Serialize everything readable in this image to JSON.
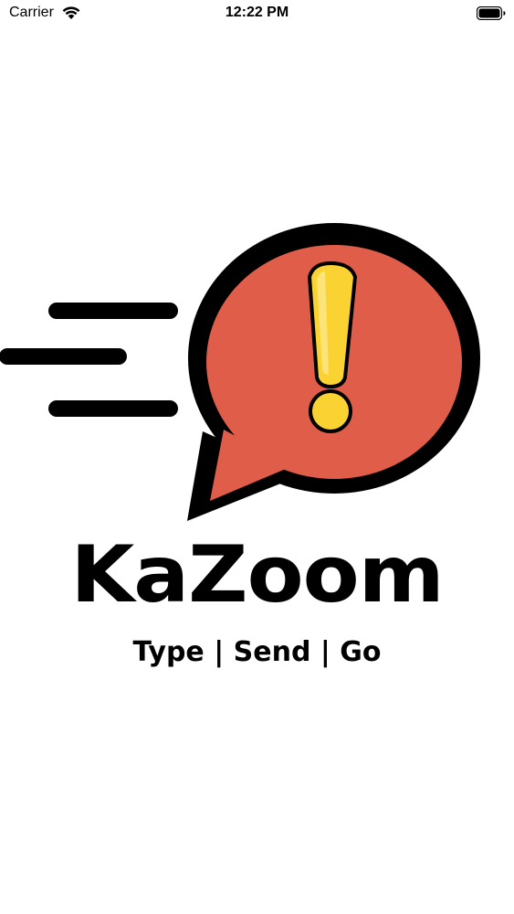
{
  "status_bar": {
    "carrier": "Carrier",
    "time": "12:22 PM",
    "wifi_icon": "wifi-icon",
    "battery_icon": "battery-icon"
  },
  "splash": {
    "logo_icon": "speech-bubble-exclamation-icon",
    "app_name": "KaZoom",
    "tagline": "Type | Send | Go",
    "colors": {
      "bubble": "#e05d4a",
      "outline": "#000000",
      "exclamation": "#fad333",
      "background": "#ffffff"
    }
  }
}
